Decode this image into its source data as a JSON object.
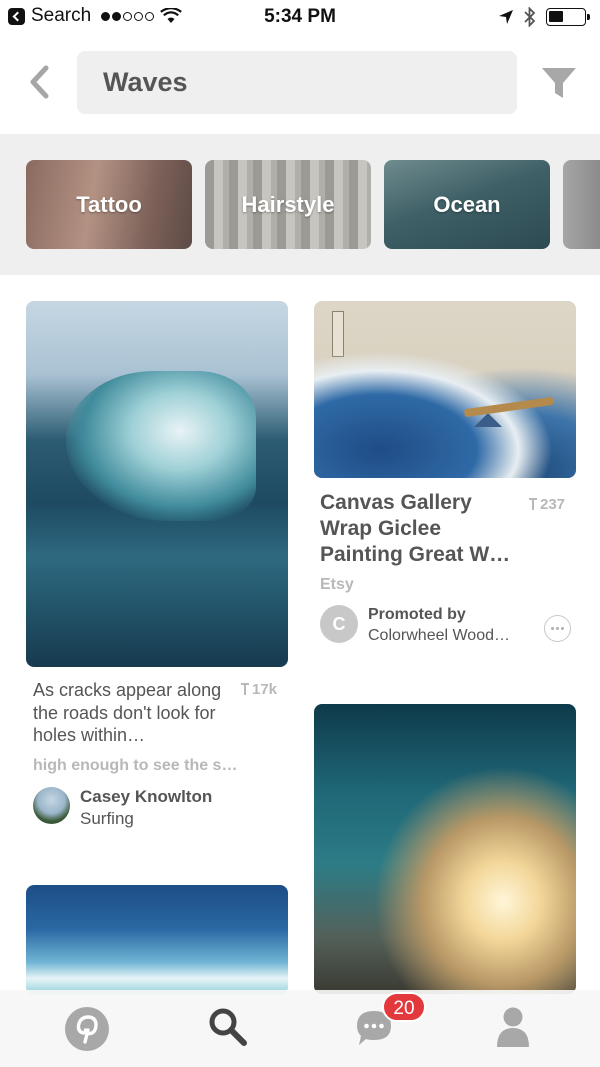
{
  "status_bar": {
    "back_label": "Search",
    "time": "5:34 PM",
    "signal_bars_filled": 2,
    "signal_bars_total": 5
  },
  "search": {
    "query": "Waves"
  },
  "categories": [
    {
      "label": "Tattoo"
    },
    {
      "label": "Hairstyle"
    },
    {
      "label": "Ocean"
    }
  ],
  "pins": {
    "left1": {
      "description": "As cracks appear along the roads don't look for holes within…",
      "saves": "17k",
      "more_text": "high enough to see the s…",
      "user_name": "Casey Knowlton",
      "board": "Surfing"
    },
    "right1": {
      "title": "Canvas Gallery Wrap Giclee Painting Great W…",
      "saves": "237",
      "source": "Etsy",
      "promoted_label": "Promoted by",
      "promoter": "Colorwheel Wood…",
      "avatar_letter": "C"
    }
  },
  "tab_bar": {
    "notification_count": "20",
    "icons": [
      "pinterest-icon",
      "search-icon",
      "chat-icon",
      "profile-icon"
    ]
  },
  "colors": {
    "brand_red": "#e3393c",
    "search_bg": "#efefef",
    "icon_gray": "#a8a8a8",
    "active_icon": "#444444"
  }
}
